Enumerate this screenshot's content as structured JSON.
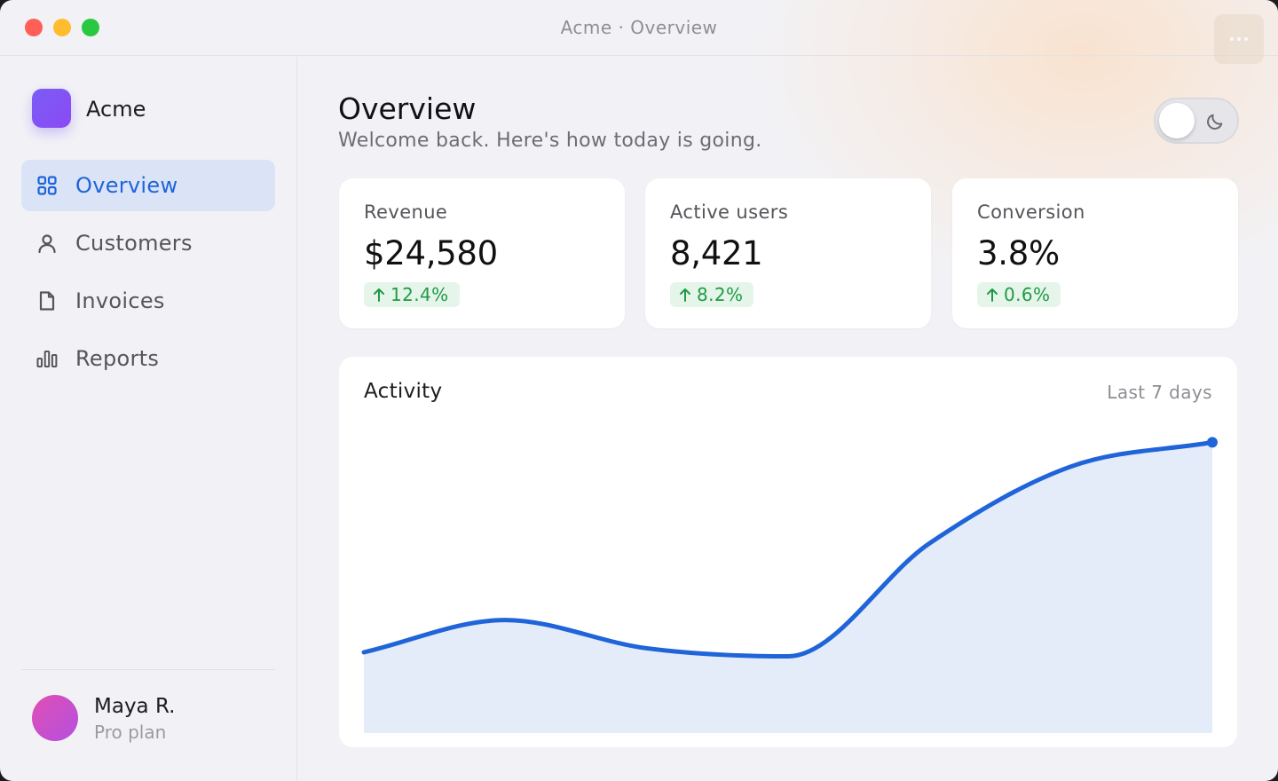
{
  "window": {
    "title": "Acme · Overview"
  },
  "colors": {
    "accent": "#1f64d8",
    "positive": "#1f9a45",
    "chart_fill": "#e4ecf9"
  },
  "sidebar": {
    "brand": "Acme",
    "items": [
      {
        "label": "Overview",
        "icon": "grid-icon",
        "active": true
      },
      {
        "label": "Customers",
        "icon": "user-icon",
        "active": false
      },
      {
        "label": "Invoices",
        "icon": "document-icon",
        "active": false
      },
      {
        "label": "Reports",
        "icon": "bar-chart-icon",
        "active": false
      }
    ],
    "user": {
      "name": "Maya R.",
      "plan": "Pro plan"
    }
  },
  "header": {
    "title": "Overview",
    "subtitle": "Welcome back. Here's how today is going.",
    "theme_toggle": {
      "icon": "moon-icon",
      "dark_mode": false
    }
  },
  "stats": [
    {
      "label": "Revenue",
      "value": "$24,580",
      "change": "12.4%"
    },
    {
      "label": "Active users",
      "value": "8,421",
      "change": "8.2%"
    },
    {
      "label": "Conversion",
      "value": "3.8%",
      "change": "0.6%"
    }
  ],
  "activity": {
    "title": "Activity",
    "range_label": "Last 7 days"
  },
  "chart_data": {
    "type": "area",
    "title": "Activity",
    "x": [
      1,
      2,
      3,
      4,
      5,
      6,
      7
    ],
    "series": [
      {
        "values": [
          20,
          28,
          21,
          19,
          47,
          66,
          72
        ]
      }
    ],
    "ylim": [
      0,
      80
    ],
    "grid": false,
    "legend": "none"
  }
}
